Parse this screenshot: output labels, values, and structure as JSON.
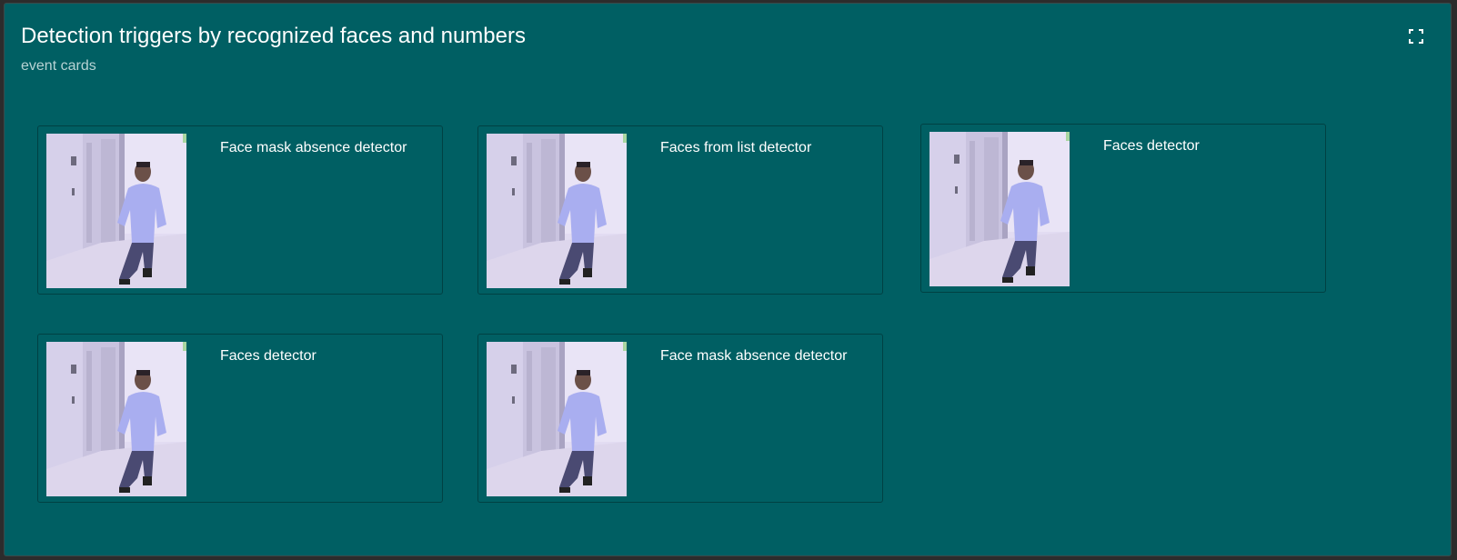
{
  "panel": {
    "title": "Detection triggers by recognized faces and numbers",
    "subtitle": "event cards",
    "fullscreen_icon": "fullscreen-icon"
  },
  "cards": [
    {
      "label": "Face mask absence detector",
      "image": "person-in-corridor-snapshot"
    },
    {
      "label": "Faces from list detector",
      "image": "person-in-corridor-snapshot"
    },
    {
      "label": "Faces detector",
      "image": "person-in-corridor-snapshot"
    },
    {
      "label": "Faces detector",
      "image": "person-in-corridor-snapshot"
    },
    {
      "label": "Face mask absence detector",
      "image": "person-in-corridor-snapshot"
    }
  ],
  "colors": {
    "panel_background": "#005f63",
    "page_background": "#2c2c2c",
    "title_text": "#ffffff",
    "subtitle_text": "#b7d3d4"
  }
}
